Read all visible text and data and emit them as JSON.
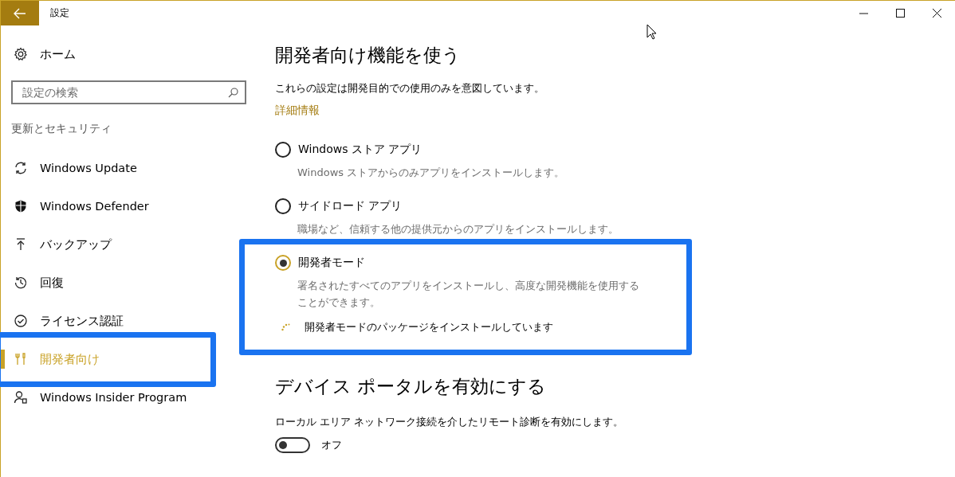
{
  "window": {
    "title": "設定"
  },
  "sidebar": {
    "home": "ホーム",
    "search": {
      "placeholder": "設定の検索"
    },
    "section": "更新とセキュリティ",
    "items": [
      {
        "label": "Windows Update",
        "selected": false,
        "highlighted": false
      },
      {
        "label": "Windows Defender",
        "selected": false,
        "highlighted": false
      },
      {
        "label": "バックアップ",
        "selected": false,
        "highlighted": false
      },
      {
        "label": "回復",
        "selected": false,
        "highlighted": false
      },
      {
        "label": "ライセンス認証",
        "selected": false,
        "highlighted": false
      },
      {
        "label": "開発者向け",
        "selected": true,
        "highlighted": true
      },
      {
        "label": "Windows Insider Program",
        "selected": false,
        "highlighted": false
      }
    ]
  },
  "developer": {
    "heading": "開発者向け機能を使う",
    "description": "これらの設定は開発目的での使用のみを意図しています。",
    "link": "詳細情報",
    "options": [
      {
        "label": "Windows ストア アプリ",
        "description": "Windows ストアからのみアプリをインストールします。",
        "selected": false,
        "highlighted": false
      },
      {
        "label": "サイドロード アプリ",
        "description": "職場など、信頼する他の提供元からのアプリをインストールします。",
        "selected": false,
        "highlighted": false
      },
      {
        "label": "開発者モード",
        "description": "署名されたすべてのアプリをインストールし、高度な開発機能を使用することができます。",
        "selected": true,
        "highlighted": true,
        "progress": "開発者モードのパッケージをインストールしています"
      }
    ]
  },
  "device_portal": {
    "heading": "デバイス ポータルを有効にする",
    "description": "ローカル エリア ネットワーク接続を介したリモート診断を有効にします。",
    "toggle": {
      "on": false,
      "label": "オフ"
    }
  }
}
